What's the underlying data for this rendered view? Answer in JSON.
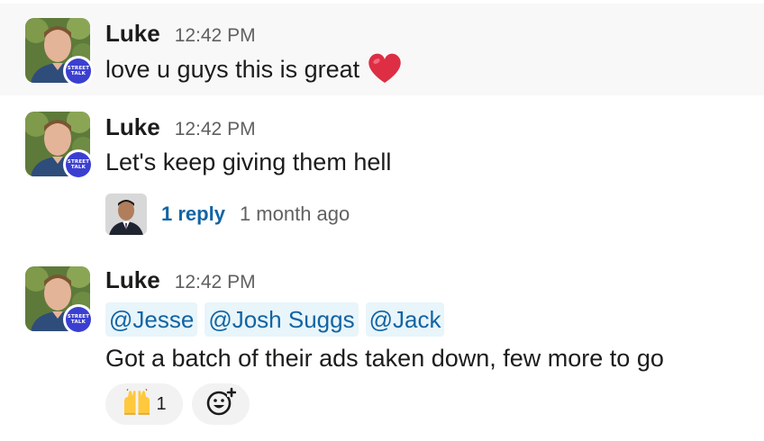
{
  "messages": [
    {
      "author": "Luke",
      "time": "12:42 PM",
      "text": "love u guys this is great",
      "emoji": "red-heart"
    },
    {
      "author": "Luke",
      "time": "12:42 PM",
      "text": "Let's keep giving them hell",
      "thread": {
        "reply_count": "1 reply",
        "last_reply": "1 month ago"
      }
    },
    {
      "author": "Luke",
      "time": "12:42 PM",
      "mentions": [
        "@Jesse",
        "@Josh Suggs",
        "@Jack"
      ],
      "text": "Got a batch of their ads taken down, few more to go",
      "reactions": [
        {
          "emoji": "raising-hands",
          "count": "1"
        }
      ],
      "add_reaction_icon": "add-reaction-icon"
    }
  ],
  "badge": {
    "line1": "STREET",
    "line2": "TALK"
  },
  "colors": {
    "link": "#1264a3",
    "mention_bg": "#e8f5fa",
    "badge": "#3b3fd1",
    "hover_bg": "#f8f8f8"
  }
}
